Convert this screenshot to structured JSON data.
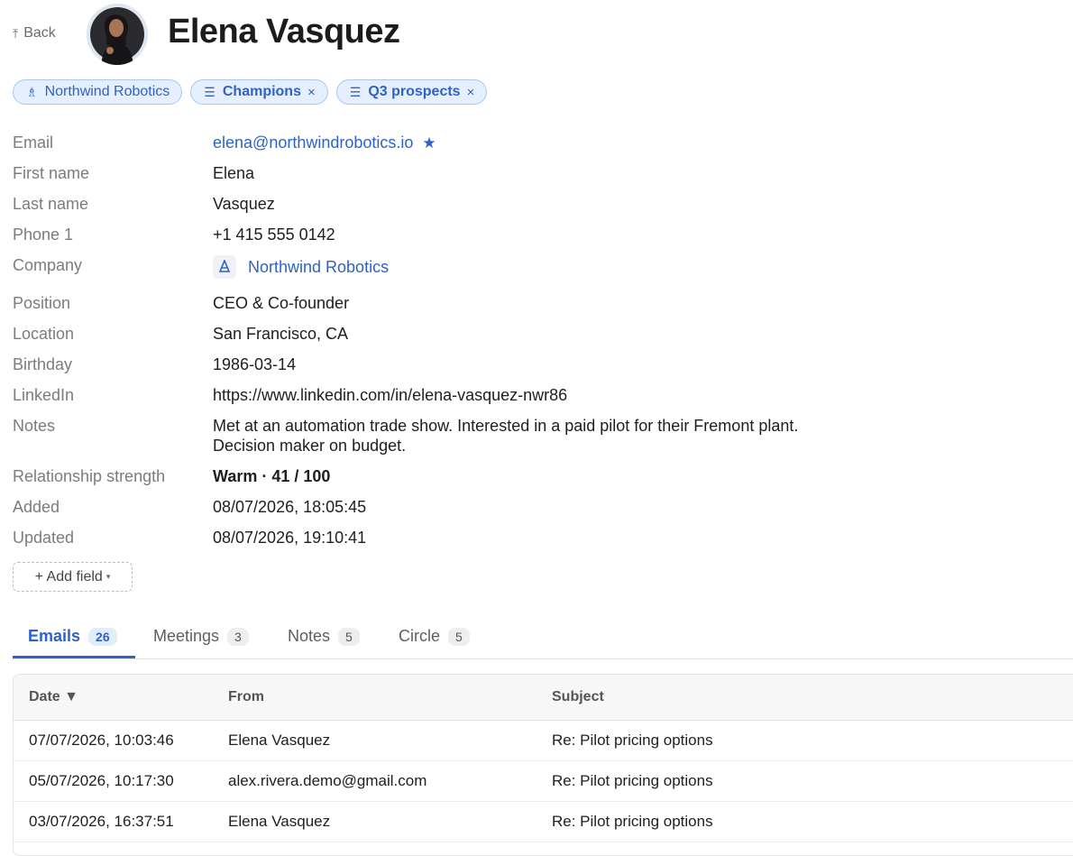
{
  "header": {
    "back_label": "Back",
    "back_icon": "back-arrow-icon",
    "name": "Elena Vasquez"
  },
  "chips": [
    {
      "label": "Northwind Robotics",
      "icon": "company-logo-icon"
    },
    {
      "label": "Champions",
      "icon": "list-icon",
      "remove": "×"
    },
    {
      "label": "Q3 prospects",
      "icon": "list-icon",
      "remove": "×"
    }
  ],
  "fields": {
    "email": {
      "label": "Email",
      "value": "elena@northwindrobotics.io",
      "star": "★"
    },
    "first_name": {
      "label": "First name",
      "value": "Elena"
    },
    "last_name": {
      "label": "Last name",
      "value": "Vasquez"
    },
    "phone": {
      "label": "Phone 1",
      "value": "+1 415 555 0142"
    },
    "company": {
      "label": "Company",
      "value": "Northwind Robotics"
    },
    "position": {
      "label": "Position",
      "value": "CEO & Co-founder"
    },
    "location": {
      "label": "Location",
      "value": "San Francisco, CA"
    },
    "birthday": {
      "label": "Birthday",
      "value": "1986-03-14"
    },
    "linkedin": {
      "label": "LinkedIn",
      "value": "https://www.linkedin.com/in/elena-vasquez-nwr86"
    },
    "notes": {
      "label": "Notes",
      "value": "Met at an automation trade show. Interested in a paid pilot for their Fremont plant. Decision maker on budget."
    },
    "relationship": {
      "label": "Relationship strength",
      "value": "Warm · 41 / 100"
    },
    "added": {
      "label": "Added",
      "value": "08/07/2026, 18:05:45"
    },
    "updated": {
      "label": "Updated",
      "value": "08/07/2026, 19:10:41"
    }
  },
  "add_field": {
    "label": "+ Add field",
    "caret": "▾"
  },
  "tabs": [
    {
      "label": "Emails",
      "count": "26",
      "active": true
    },
    {
      "label": "Meetings",
      "count": "3"
    },
    {
      "label": "Notes",
      "count": "5"
    },
    {
      "label": "Circle",
      "count": "5"
    }
  ],
  "table": {
    "columns": [
      "Date ▼",
      "From",
      "Subject"
    ],
    "rows": [
      [
        "07/07/2026, 10:03:46",
        "Elena Vasquez",
        "Re: Pilot pricing options"
      ],
      [
        "05/07/2026, 10:17:30",
        "alex.rivera.demo@gmail.com",
        "Re: Pilot pricing options"
      ],
      [
        "03/07/2026, 16:37:51",
        "Elena Vasquez",
        "Re: Pilot pricing options"
      ]
    ]
  },
  "colors": {
    "accent": "#2f62c6",
    "warm": "#c28a1c",
    "chip_bg": "#e5efff"
  }
}
